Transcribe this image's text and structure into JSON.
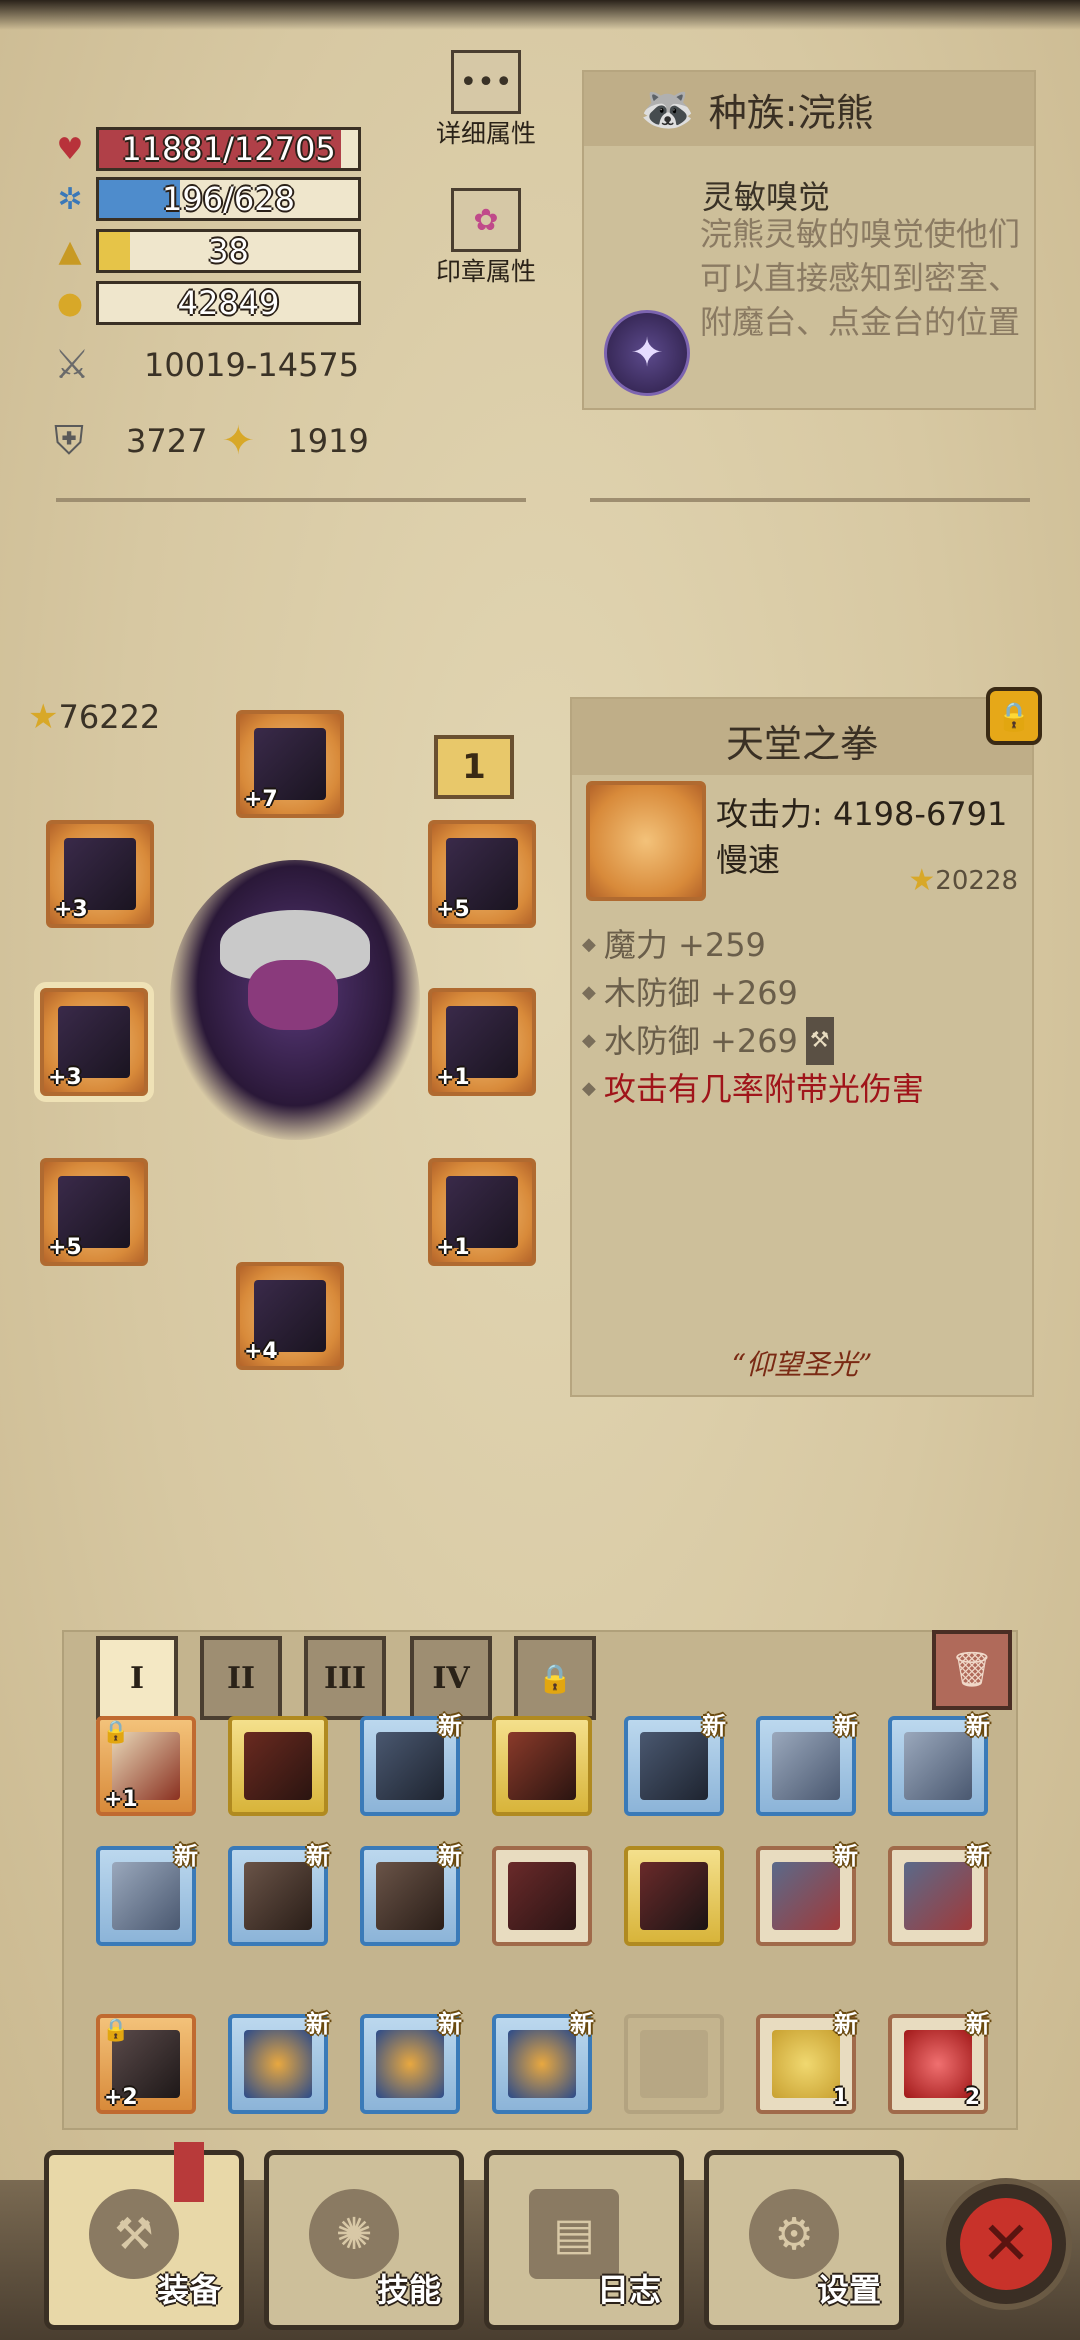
{
  "stats": {
    "hp": "11881/12705",
    "hp_fraction": 0.935,
    "mp": "196/628",
    "mp_fraction": 0.312,
    "level": "38",
    "level_fraction": 0.12,
    "gold": "42849",
    "attack": "10019-14575",
    "defense": "3727",
    "crit": "1919"
  },
  "buttons": {
    "detail_attrs": "详细属性",
    "seal_attrs": "印章属性"
  },
  "race": {
    "title": "种族:浣熊",
    "skill_name": "灵敏嗅觉",
    "skill_desc": "浣熊灵敏的嗅觉使他们可以直接感知到密室、附魔台、点金台的位置"
  },
  "equipment": {
    "score": "76222",
    "page_tag": "1",
    "slots": [
      {
        "level": "+7"
      },
      {
        "level": "+3"
      },
      {
        "level": "+5"
      },
      {
        "level": "+3"
      },
      {
        "level": "+1"
      },
      {
        "level": "+5"
      },
      {
        "level": "+1"
      },
      {
        "level": "+4"
      }
    ]
  },
  "item": {
    "name": "天堂之拳",
    "attack": "攻击力: 4198-6791",
    "speed": "慢速",
    "score": "20228",
    "stats": [
      "魔力 +259",
      "木防御 +269",
      "水防御 +269"
    ],
    "special": "攻击有几率附带光伤害",
    "quote": "“仰望圣光”"
  },
  "inventory": {
    "tabs": [
      "I",
      "II",
      "III",
      "IV"
    ],
    "new_label": "新",
    "row1": [
      {
        "lvl": "+1",
        "locked": true
      },
      {
        "lvl": ""
      },
      {
        "lvl": ""
      },
      {
        "lvl": ""
      },
      {
        "lvl": ""
      },
      {
        "lvl": ""
      },
      {
        "lvl": ""
      }
    ],
    "row3": [
      {
        "lvl": "+2"
      },
      {
        "cnt": "1"
      },
      {
        "cnt": "2"
      }
    ]
  },
  "nav": {
    "equip": "装备",
    "skills": "技能",
    "log": "日志",
    "settings": "设置"
  }
}
